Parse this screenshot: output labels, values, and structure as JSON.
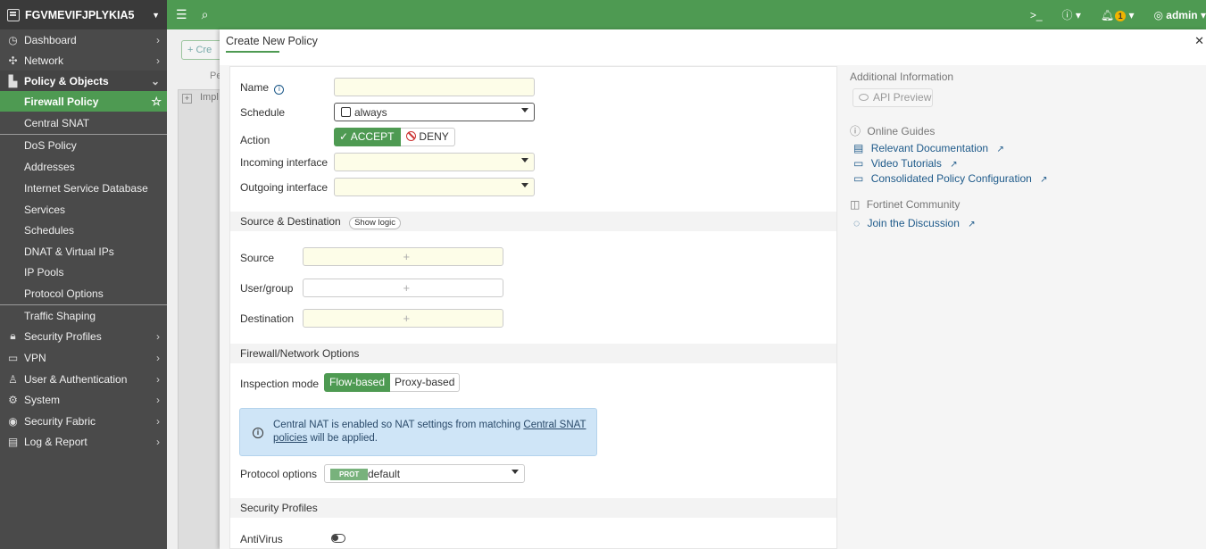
{
  "device": {
    "name": "FGVMEVIFJPLYKIA5"
  },
  "sidebar": {
    "items": [
      {
        "label": "Dashboard",
        "icon": "dashboard-icon"
      },
      {
        "label": "Network",
        "icon": "network-icon"
      },
      {
        "label": "Policy & Objects",
        "icon": "policy-icon"
      },
      {
        "label": "Security Profiles",
        "icon": "lock-icon"
      },
      {
        "label": "VPN",
        "icon": "laptop-icon"
      },
      {
        "label": "User & Authentication",
        "icon": "user-icon"
      },
      {
        "label": "System",
        "icon": "gear-icon"
      },
      {
        "label": "Security Fabric",
        "icon": "fabric-icon"
      },
      {
        "label": "Log & Report",
        "icon": "chart-icon"
      }
    ],
    "subitems": [
      "Firewall Policy",
      "Central SNAT",
      "DoS Policy",
      "Addresses",
      "Internet Service Database",
      "Services",
      "Schedules",
      "DNAT & Virtual IPs",
      "IP Pools",
      "Protocol Options",
      "Traffic Shaping"
    ]
  },
  "topbar": {
    "user": "admin",
    "notifications": "1"
  },
  "background": {
    "create_label": "+ Cre",
    "col_label": "Pe",
    "row_label": "Impl"
  },
  "panel": {
    "title": "Create New Policy",
    "form": {
      "name_label": "Name",
      "schedule_label": "Schedule",
      "schedule_value": "always",
      "action_label": "Action",
      "accept_label": "ACCEPT",
      "deny_label": "DENY",
      "incoming_label": "Incoming interface",
      "outgoing_label": "Outgoing interface",
      "src_dst_section": "Source & Destination",
      "show_logic": "Show logic",
      "source_label": "Source",
      "usergroup_label": "User/group",
      "destination_label": "Destination",
      "fw_section": "Firewall/Network Options",
      "inspection_label": "Inspection mode",
      "flow_label": "Flow-based",
      "proxy_label": "Proxy-based",
      "info_text_1": "Central NAT is enabled so NAT settings from matching ",
      "info_link": "Central SNAT policies",
      "info_text_2": " will be applied.",
      "protocol_label": "Protocol options",
      "protocol_badge": "PROT",
      "protocol_value": "default",
      "secprof_section": "Security Profiles",
      "antivirus_label": "AntiVirus"
    },
    "right": {
      "additional_info": "Additional Information",
      "api_preview": "API Preview",
      "online_guides": "Online Guides",
      "relevant_docs": "Relevant Documentation",
      "video_tutorials": "Video Tutorials",
      "consolidated": "Consolidated Policy Configuration",
      "community": "Fortinet Community",
      "join": "Join the Discussion"
    }
  }
}
